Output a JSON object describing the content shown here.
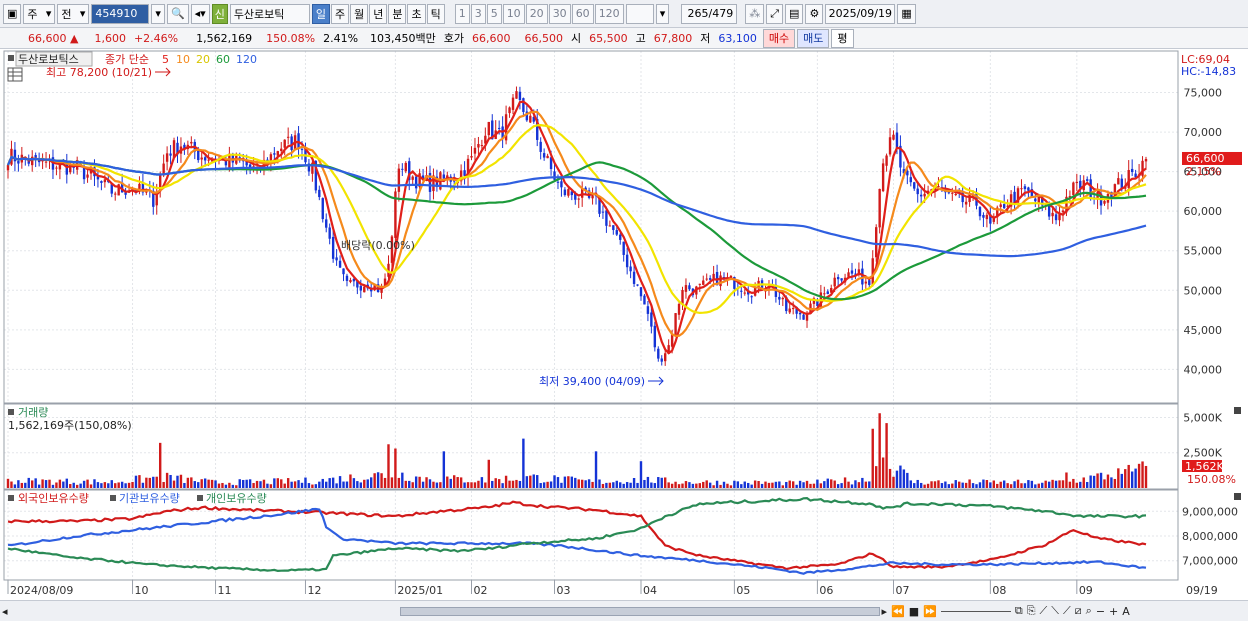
{
  "toolbar": {
    "period_label": "주",
    "prev_label": "전",
    "code": "454910",
    "stock_name": "두산로보틱",
    "new_badge": "신",
    "tabs": [
      "일",
      "주",
      "월",
      "년",
      "분",
      "초",
      "틱"
    ],
    "selected_tab": "일",
    "minute_options": [
      "1",
      "3",
      "5",
      "10",
      "20",
      "30",
      "60",
      "120"
    ],
    "count_value": "265",
    "count_total": "/479",
    "date_value": "2025/09/19"
  },
  "quote": {
    "price": "66,600",
    "change": "1,600",
    "change_pct": "+2.46%",
    "volume": "1,562,169",
    "volume_ratio": "150.08%",
    "turnover_pct": "2.41%",
    "amount": "103,450백만",
    "hoga_label": "호가",
    "ask": "66,600",
    "bid": "66,500",
    "open_label": "시",
    "open": "65,500",
    "high_label": "고",
    "high": "67,800",
    "low_label": "저",
    "low": "63,100",
    "buy_label": "매수",
    "sell_label": "매도",
    "avg_label": "평"
  },
  "price_panel": {
    "legend_name": "두산로보틱스",
    "legend_ma_label": "종가 단순",
    "ma_periods": [
      "5",
      "10",
      "20",
      "60",
      "120"
    ],
    "max_label": "최고 78,200 (10/21)",
    "min_label": "최저 39,400 (04/09)",
    "dividend_label": "배당락(0.00%)",
    "lc_label": "LC:69,04",
    "hc_label": "HC:-14,83",
    "last_price_tag": "66,600",
    "last_pct_tag": "2.15%"
  },
  "volume_panel": {
    "title": "거래량",
    "value_label": "1,562,169주(150,08%)",
    "last_tag": "1,562K",
    "last_pct_tag": "150.08%"
  },
  "holding_panel": {
    "legend": [
      "외국인보유수량",
      "기관보유수량",
      "개인보유수량"
    ]
  },
  "x_axis": {
    "labels": [
      {
        "text": "2024/08/09",
        "i": 0
      },
      {
        "text": "10",
        "i": 36
      },
      {
        "text": "11",
        "i": 60
      },
      {
        "text": "12",
        "i": 86
      },
      {
        "text": "2025/01",
        "i": 112
      },
      {
        "text": "02",
        "i": 134
      },
      {
        "text": "03",
        "i": 158
      },
      {
        "text": "04",
        "i": 183
      },
      {
        "text": "05",
        "i": 210
      },
      {
        "text": "06",
        "i": 234
      },
      {
        "text": "07",
        "i": 256
      },
      {
        "text": "08",
        "i": 284
      },
      {
        "text": "09",
        "i": 309
      }
    ],
    "end_label": "09/19"
  },
  "chart_data": {
    "type": "candlestick",
    "n": 330,
    "price_axis": {
      "ticks": [
        40000,
        45000,
        50000,
        55000,
        60000,
        65000,
        70000,
        75000
      ],
      "ylim": [
        36000,
        80000
      ]
    },
    "volume_axis": {
      "ticks": [
        "5,000K",
        "2,500K"
      ],
      "ylim": [
        0,
        5600
      ]
    },
    "holding_axis": {
      "ticks": [
        "9,000,000",
        "8,000,000",
        "7,000,000"
      ],
      "ylim": [
        6300000,
        9700000
      ]
    },
    "price_knots": [
      [
        0,
        67000
      ],
      [
        10,
        66000
      ],
      [
        20,
        65500
      ],
      [
        30,
        62500
      ],
      [
        36,
        63000
      ],
      [
        42,
        61500
      ],
      [
        46,
        67500
      ],
      [
        50,
        68500
      ],
      [
        56,
        67000
      ],
      [
        62,
        66500
      ],
      [
        68,
        66000
      ],
      [
        72,
        65000
      ],
      [
        78,
        68000
      ],
      [
        84,
        69000
      ],
      [
        88,
        65000
      ],
      [
        92,
        58000
      ],
      [
        95,
        53000
      ],
      [
        98,
        50500
      ],
      [
        104,
        51000
      ],
      [
        108,
        50000
      ],
      [
        110,
        53000
      ],
      [
        113,
        66000
      ],
      [
        118,
        64000
      ],
      [
        122,
        63500
      ],
      [
        126,
        64000
      ],
      [
        130,
        64500
      ],
      [
        134,
        66500
      ],
      [
        138,
        70500
      ],
      [
        142,
        69500
      ],
      [
        147,
        74000
      ],
      [
        151,
        71500
      ],
      [
        155,
        67000
      ],
      [
        160,
        62500
      ],
      [
        165,
        62000
      ],
      [
        170,
        61000
      ],
      [
        175,
        57500
      ],
      [
        180,
        52500
      ],
      [
        185,
        47000
      ],
      [
        188,
        41000
      ],
      [
        191,
        43000
      ],
      [
        195,
        50500
      ],
      [
        199,
        50000
      ],
      [
        205,
        51500
      ],
      [
        210,
        51000
      ],
      [
        215,
        50000
      ],
      [
        220,
        51000
      ],
      [
        225,
        47500
      ],
      [
        230,
        47000
      ],
      [
        235,
        49000
      ],
      [
        240,
        52000
      ],
      [
        245,
        52000
      ],
      [
        249,
        51000
      ],
      [
        253,
        67000
      ],
      [
        256,
        69000
      ],
      [
        259,
        64000
      ],
      [
        263,
        62000
      ],
      [
        268,
        63000
      ],
      [
        273,
        61500
      ],
      [
        280,
        61000
      ],
      [
        284,
        58000
      ],
      [
        288,
        61000
      ],
      [
        294,
        62500
      ],
      [
        298,
        61000
      ],
      [
        303,
        59000
      ],
      [
        307,
        62500
      ],
      [
        311,
        63500
      ],
      [
        315,
        61500
      ],
      [
        320,
        63000
      ],
      [
        325,
        64500
      ],
      [
        329,
        66600
      ]
    ],
    "volume_knots": [
      [
        0,
        600
      ],
      [
        30,
        500
      ],
      [
        45,
        900
      ],
      [
        60,
        450
      ],
      [
        90,
        600
      ],
      [
        112,
        1200
      ],
      [
        120,
        800
      ],
      [
        140,
        650
      ],
      [
        150,
        900
      ],
      [
        170,
        500
      ],
      [
        183,
        700
      ],
      [
        195,
        500
      ],
      [
        230,
        400
      ],
      [
        248,
        700
      ],
      [
        253,
        2500
      ],
      [
        262,
        500
      ],
      [
        300,
        450
      ],
      [
        310,
        700
      ],
      [
        329,
        1562
      ]
    ],
    "volume_spikes": [
      [
        44,
        3200
      ],
      [
        110,
        3100
      ],
      [
        112,
        2800
      ],
      [
        126,
        2600
      ],
      [
        139,
        2000
      ],
      [
        149,
        3500
      ],
      [
        170,
        2600
      ],
      [
        183,
        1900
      ],
      [
        250,
        4200
      ],
      [
        252,
        5300
      ],
      [
        254,
        4600
      ],
      [
        306,
        1100
      ],
      [
        322,
        1000
      ],
      [
        329,
        1562
      ]
    ],
    "foreign_knots": [
      [
        0,
        8600000
      ],
      [
        20,
        8600000
      ],
      [
        36,
        8700000
      ],
      [
        46,
        9000000
      ],
      [
        56,
        9150000
      ],
      [
        70,
        9050000
      ],
      [
        90,
        8950000
      ],
      [
        112,
        8800000
      ],
      [
        125,
        9000000
      ],
      [
        138,
        9150000
      ],
      [
        146,
        9350000
      ],
      [
        155,
        9200000
      ],
      [
        170,
        9050000
      ],
      [
        183,
        8800000
      ],
      [
        190,
        7600000
      ],
      [
        200,
        7200000
      ],
      [
        215,
        6900000
      ],
      [
        225,
        6700000
      ],
      [
        240,
        6850000
      ],
      [
        250,
        7300000
      ],
      [
        256,
        6750000
      ],
      [
        270,
        6750000
      ],
      [
        285,
        7050000
      ],
      [
        300,
        7650000
      ],
      [
        308,
        8250000
      ],
      [
        315,
        7900000
      ],
      [
        329,
        7650000
      ]
    ],
    "inst_knots": [
      [
        0,
        7600000
      ],
      [
        20,
        8000000
      ],
      [
        40,
        8300000
      ],
      [
        60,
        8600000
      ],
      [
        80,
        8900000
      ],
      [
        90,
        9100000
      ],
      [
        92,
        8400000
      ],
      [
        96,
        7900000
      ],
      [
        112,
        7700000
      ],
      [
        130,
        7700000
      ],
      [
        150,
        7700000
      ],
      [
        160,
        7600000
      ],
      [
        183,
        7200000
      ],
      [
        200,
        7000000
      ],
      [
        220,
        6700000
      ],
      [
        230,
        6500000
      ],
      [
        245,
        6700000
      ],
      [
        255,
        6900000
      ],
      [
        270,
        6850000
      ],
      [
        285,
        6850000
      ],
      [
        300,
        6900000
      ],
      [
        315,
        6950000
      ],
      [
        329,
        6700000
      ]
    ],
    "indiv_knots": [
      [
        0,
        7500000
      ],
      [
        10,
        7300000
      ],
      [
        20,
        7100000
      ],
      [
        30,
        7000000
      ],
      [
        40,
        6850000
      ],
      [
        60,
        6700000
      ],
      [
        80,
        6600000
      ],
      [
        92,
        6650000
      ],
      [
        94,
        7200000
      ],
      [
        112,
        7500000
      ],
      [
        130,
        7400000
      ],
      [
        140,
        7500000
      ],
      [
        150,
        7700000
      ],
      [
        160,
        7800000
      ],
      [
        170,
        7900000
      ],
      [
        183,
        8300000
      ],
      [
        190,
        8800000
      ],
      [
        200,
        9300000
      ],
      [
        215,
        9400000
      ],
      [
        230,
        9500000
      ],
      [
        250,
        9300000
      ],
      [
        253,
        9100000
      ],
      [
        260,
        9300000
      ],
      [
        270,
        9300000
      ],
      [
        285,
        9200000
      ],
      [
        300,
        9000000
      ],
      [
        310,
        8800000
      ],
      [
        329,
        8800000
      ]
    ]
  },
  "status": {
    "zoom_minus": "−",
    "zoom_plus": "+",
    "auto_label": "A"
  },
  "colors": {
    "up": "#d11a1a",
    "down": "#1433d6",
    "ma5": "#e0201a",
    "ma10": "#f58a1c",
    "ma20": "#f2e400",
    "ma60": "#1c9a3a",
    "ma120": "#2f5fe0",
    "foreign": "#d11a1a",
    "inst": "#2f5fe0",
    "indiv": "#2a8a55"
  }
}
